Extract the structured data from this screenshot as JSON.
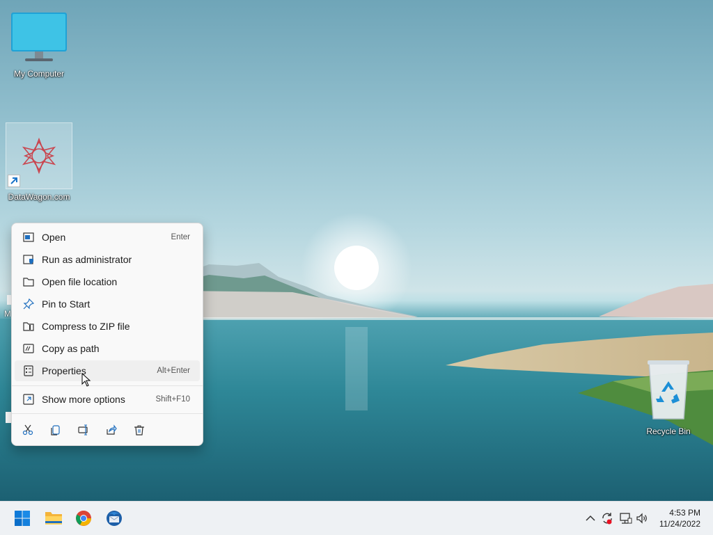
{
  "desktop": {
    "icons": {
      "my_computer": {
        "label": "My Computer",
        "icon": "monitor-icon"
      },
      "datawagon": {
        "label": "DataWagon.com",
        "icon": "datawagon-logo-icon"
      },
      "recycle_bin": {
        "label": "Recycle Bin",
        "icon": "recycle-bin-icon"
      }
    },
    "partial_labels": {
      "left_edge": "M"
    }
  },
  "context_menu": {
    "items": [
      {
        "label": "Open",
        "accelerator": "Enter",
        "icon": "open-window-icon"
      },
      {
        "label": "Run as administrator",
        "accelerator": "",
        "icon": "admin-shield-icon"
      },
      {
        "label": "Open file location",
        "accelerator": "",
        "icon": "folder-icon"
      },
      {
        "label": "Pin to Start",
        "accelerator": "",
        "icon": "pin-icon"
      },
      {
        "label": "Compress to ZIP file",
        "accelerator": "",
        "icon": "zip-folder-icon"
      },
      {
        "label": "Copy as path",
        "accelerator": "",
        "icon": "copy-path-icon"
      },
      {
        "label": "Properties",
        "accelerator": "Alt+Enter",
        "icon": "properties-icon"
      },
      {
        "label": "Show more options",
        "accelerator": "Shift+F10",
        "icon": "more-options-icon"
      }
    ],
    "quick_actions": [
      "cut-icon",
      "copy-icon",
      "rename-icon",
      "share-icon",
      "delete-icon"
    ]
  },
  "taskbar": {
    "apps": [
      "windows-start-icon",
      "file-explorer-icon",
      "chrome-icon",
      "thunderbird-icon"
    ],
    "tray": [
      "chevron-up-icon",
      "sync-icon",
      "network-icon",
      "volume-icon"
    ],
    "clock": {
      "time": "4:53 PM",
      "date": "11/24/2022"
    }
  },
  "colors": {
    "menu_bg": "#f9f9f9",
    "hover_bg": "#efefef",
    "accent": "#0067c0",
    "taskbar_bg": "#eef1f4"
  }
}
